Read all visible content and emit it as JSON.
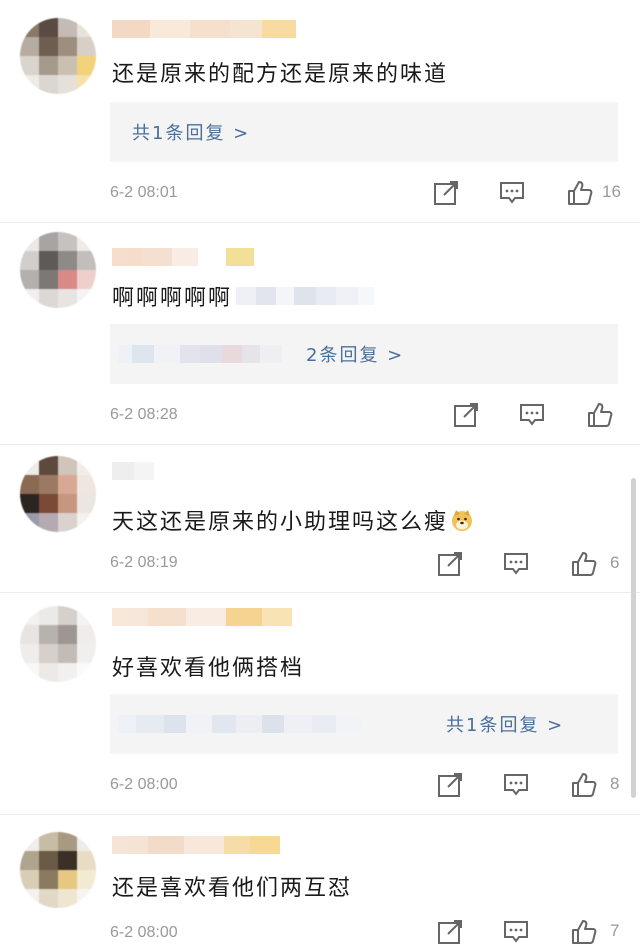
{
  "comments": [
    {
      "text": "还是原来的配方还是原来的味道",
      "reply_link": "共1条回复 >",
      "time": "6-2 08:01",
      "likes": "16"
    },
    {
      "text": "啊啊啊啊啊",
      "reply_link": "2条回复 >",
      "time": "6-2 08:28",
      "likes": ""
    },
    {
      "text": "天这还是原来的小助理吗这么瘦",
      "emoji": "doge-emoji",
      "time": "6-2 08:19",
      "likes": "6"
    },
    {
      "text": "好喜欢看他俩搭档",
      "reply_link": "共1条回复 >",
      "time": "6-2 08:00",
      "likes": "8"
    },
    {
      "text": "还是喜欢看他们两互怼",
      "time": "6-2 08:00",
      "likes": "7"
    }
  ],
  "icons": {
    "share": "share-icon",
    "comment": "comment-icon",
    "like": "thumbs-up-icon"
  },
  "colors": {
    "link": "#4a6f9c",
    "meta": "#999999",
    "reply_bg": "#f4f4f4"
  }
}
